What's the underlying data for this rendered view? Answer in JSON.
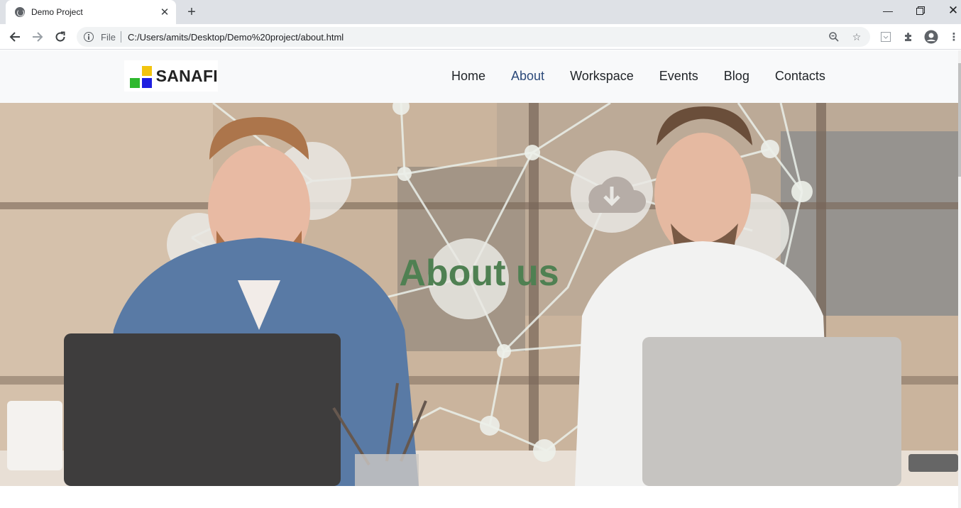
{
  "browser": {
    "tab_title": "Demo Project",
    "scheme_label": "File",
    "url": "C:/Users/amits/Desktop/Demo%20project/about.html",
    "icons": {
      "tab": "globe-icon",
      "tab_close": "close-icon",
      "new_tab": "plus-icon",
      "back": "arrow-left-icon",
      "forward": "arrow-right-icon",
      "reload": "reload-icon",
      "site_info": "info-icon",
      "zoom": "zoom-out-icon",
      "bookmark": "star-icon",
      "extension": "extension-icon",
      "puzzle": "puzzle-icon",
      "profile": "profile-icon",
      "menu": "kebab-menu-icon",
      "minimize": "minimize-icon",
      "maximize": "restore-icon",
      "close_window": "close-icon"
    }
  },
  "site": {
    "logo_text": "SANAFI",
    "nav": [
      {
        "label": "Home",
        "active": false
      },
      {
        "label": "About",
        "active": true
      },
      {
        "label": "Workspace",
        "active": false
      },
      {
        "label": "Events",
        "active": false
      },
      {
        "label": "Blog",
        "active": false
      },
      {
        "label": "Contacts",
        "active": false
      }
    ],
    "hero_title": "About us",
    "hero_image": "two-men-working-on-laptops-with-network-overlay"
  },
  "colors": {
    "nav_active": "#2c4a7a",
    "nav_text": "#212529",
    "hero_title": "#4f8052",
    "header_bg": "#f8f9fa",
    "logo_yellow": "#f2c40f",
    "logo_green": "#2eb82e",
    "logo_blue": "#1f1fe0"
  }
}
